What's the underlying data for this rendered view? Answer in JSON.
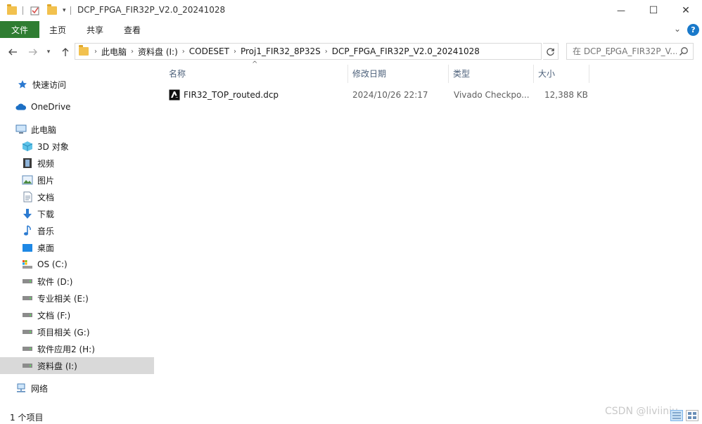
{
  "window": {
    "title": "DCP_FPGA_FIR32P_V2.0_20241028",
    "minimize_glyph": "—",
    "maximize_glyph": "☐",
    "close_glyph": "✕"
  },
  "ribbon": {
    "tabs": [
      "文件",
      "主页",
      "共享",
      "查看"
    ],
    "help_glyph": "?"
  },
  "address": {
    "crumbs": [
      "此电脑",
      "资料盘 (I:)",
      "CODESET",
      "Proj1_FIR32_8P32S",
      "DCP_FPGA_FIR32P_V2.0_20241028"
    ],
    "search_placeholder": "在 DCP_FPGA_FIR32P_V..."
  },
  "sidebar": {
    "items": [
      {
        "label": "快速访问",
        "icon": "star-icon"
      },
      {
        "label": "OneDrive",
        "icon": "cloud-icon"
      },
      {
        "label": "此电脑",
        "icon": "computer-icon"
      },
      {
        "label": "3D 对象",
        "icon": "cube-icon"
      },
      {
        "label": "视频",
        "icon": "film-icon"
      },
      {
        "label": "图片",
        "icon": "picture-icon"
      },
      {
        "label": "文档",
        "icon": "document-icon"
      },
      {
        "label": "下载",
        "icon": "download-icon"
      },
      {
        "label": "音乐",
        "icon": "music-icon"
      },
      {
        "label": "桌面",
        "icon": "desktop-icon"
      },
      {
        "label": "OS (C:)",
        "icon": "system-drive-icon"
      },
      {
        "label": "软件 (D:)",
        "icon": "drive-icon"
      },
      {
        "label": "专业相关 (E:)",
        "icon": "drive-icon"
      },
      {
        "label": "文档 (F:)",
        "icon": "drive-icon"
      },
      {
        "label": "项目相关 (G:)",
        "icon": "drive-icon"
      },
      {
        "label": "软件应用2 (H:)",
        "icon": "drive-icon"
      },
      {
        "label": "资料盘 (I:)",
        "icon": "drive-icon"
      },
      {
        "label": "网络",
        "icon": "network-icon"
      }
    ]
  },
  "columns": {
    "name": "名称",
    "modified": "修改日期",
    "type": "类型",
    "size": "大小"
  },
  "files": [
    {
      "name": "FIR32_TOP_routed.dcp",
      "modified": "2024/10/26 22:17",
      "type": "Vivado Checkpo...",
      "size": "12,388 KB"
    }
  ],
  "status": {
    "count": "1 个项目"
  },
  "watermark": "CSDN @liviiniu"
}
